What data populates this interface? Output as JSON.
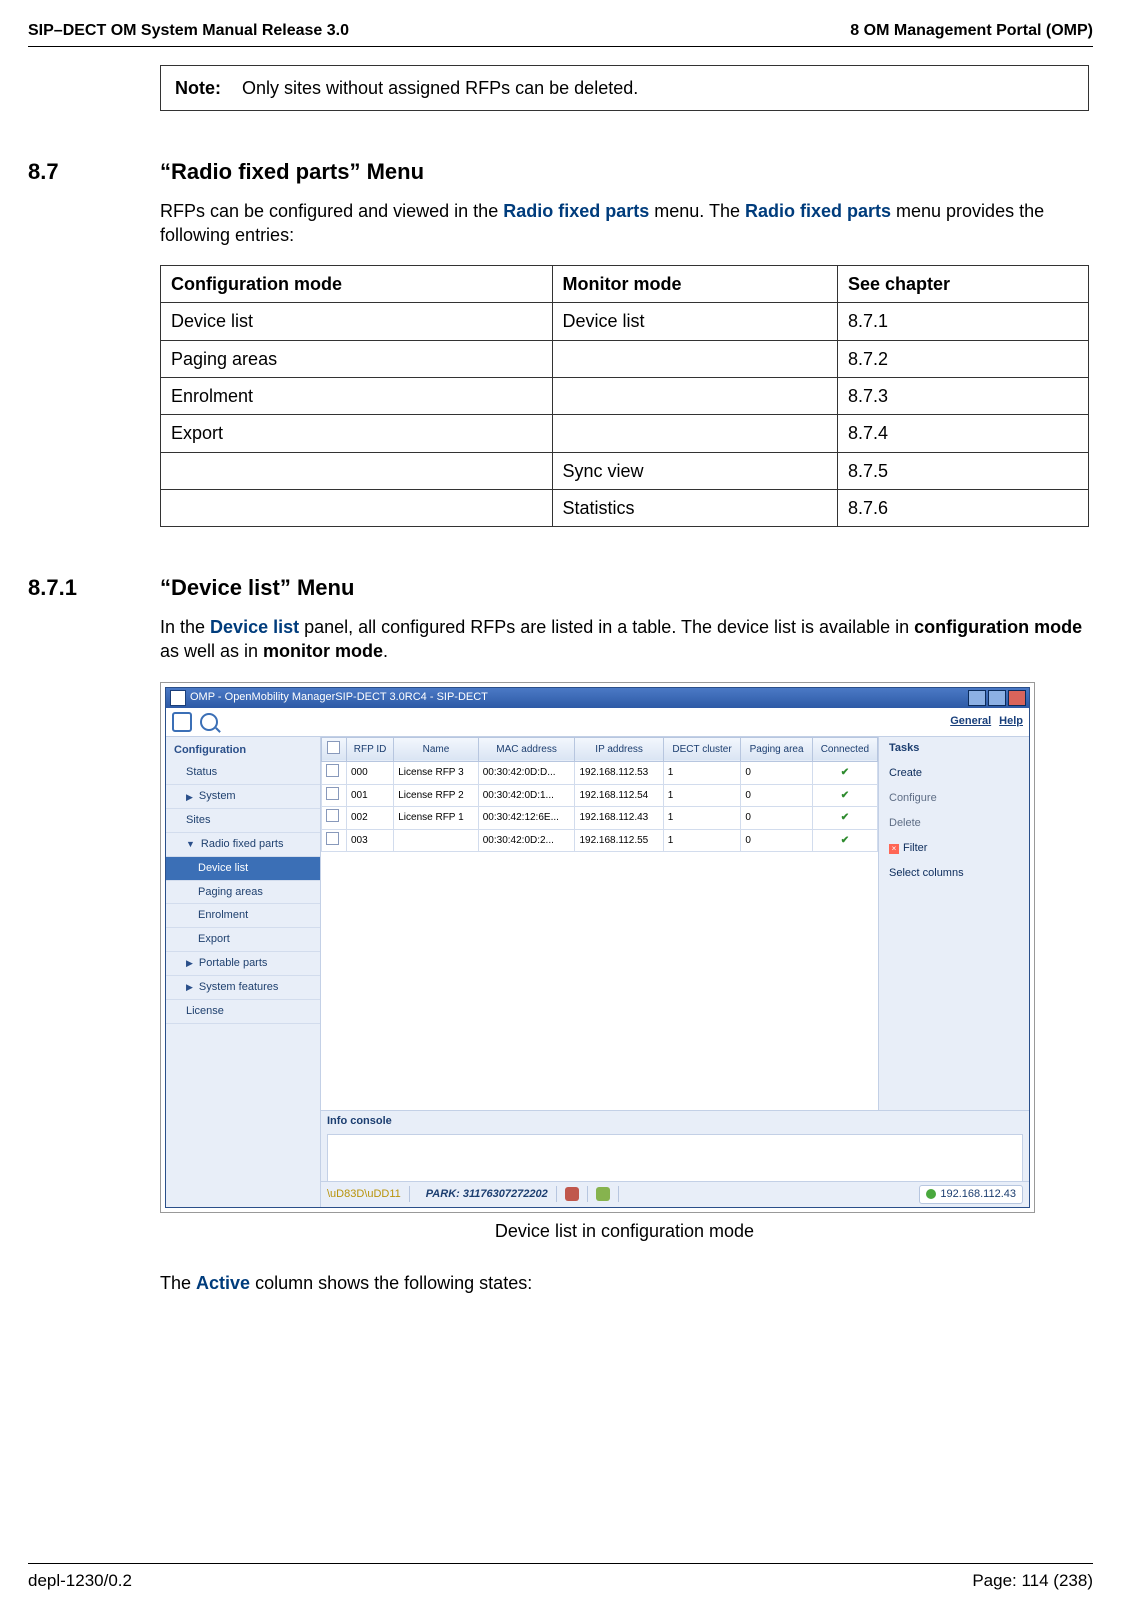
{
  "header": {
    "left": "SIP–DECT OM System Manual Release 3.0",
    "right": "8 OM Management Portal (OMP)"
  },
  "note": {
    "label": "Note:",
    "text": "Only sites without assigned RFPs can be deleted."
  },
  "sec87": {
    "num": "8.7",
    "title": "“Radio fixed parts” Menu",
    "p_pre": "RFPs can be configured and viewed in the ",
    "p_link1": "Radio fixed parts",
    "p_mid": " menu. The ",
    "p_link2": "Radio fixed parts",
    "p_post": " menu provides the following entries:",
    "thead": [
      "Configuration mode",
      "Monitor mode",
      "See chapter"
    ],
    "rows": [
      [
        "Device list",
        "Device list",
        "8.7.1"
      ],
      [
        "Paging areas",
        "",
        "8.7.2"
      ],
      [
        "Enrolment",
        "",
        "8.7.3"
      ],
      [
        "Export",
        "",
        "8.7.4"
      ],
      [
        "",
        "Sync view",
        "8.7.5"
      ],
      [
        "",
        "Statistics",
        "8.7.6"
      ]
    ]
  },
  "sec871": {
    "num": "8.7.1",
    "title": "“Device list” Menu",
    "p1_pre": "In the ",
    "p1_link": "Device list",
    "p1_mid": " panel, all configured RFPs are listed in a table. The device list is available in ",
    "p1_b1": "configuration mode",
    "p1_mid2": " as well as in ",
    "p1_b2": "monitor mode",
    "p1_end": "."
  },
  "screenshot": {
    "win_title": "OMP - OpenMobility ManagerSIP-DECT 3.0RC4 - SIP-DECT",
    "general": "General",
    "help": "Help",
    "sidebar_title": "Configuration",
    "sidebar": [
      {
        "label": "Status",
        "depth": 1,
        "sel": false,
        "arrow": ""
      },
      {
        "label": "System",
        "depth": 0,
        "sel": false,
        "arrow": "▶"
      },
      {
        "label": "Sites",
        "depth": 1,
        "sel": false,
        "arrow": ""
      },
      {
        "label": "Radio fixed parts",
        "depth": 0,
        "sel": false,
        "arrow": "▼"
      },
      {
        "label": "Device list",
        "depth": 2,
        "sel": true,
        "arrow": ""
      },
      {
        "label": "Paging areas",
        "depth": 2,
        "sel": false,
        "arrow": ""
      },
      {
        "label": "Enrolment",
        "depth": 2,
        "sel": false,
        "arrow": ""
      },
      {
        "label": "Export",
        "depth": 2,
        "sel": false,
        "arrow": ""
      },
      {
        "label": "Portable parts",
        "depth": 0,
        "sel": false,
        "arrow": "▶"
      },
      {
        "label": "System features",
        "depth": 0,
        "sel": false,
        "arrow": "▶"
      },
      {
        "label": "License",
        "depth": 1,
        "sel": false,
        "arrow": ""
      }
    ],
    "columns": [
      "",
      "RFP ID",
      "Name",
      "MAC address",
      "IP address",
      "DECT cluster",
      "Paging area",
      "Connected"
    ],
    "rows": [
      {
        "id": "000",
        "name": "License RFP 3",
        "mac": "00:30:42:0D:D...",
        "ip": "192.168.112.53",
        "cluster": "1",
        "pa": "0",
        "conn": "✔"
      },
      {
        "id": "001",
        "name": "License RFP 2",
        "mac": "00:30:42:0D:1...",
        "ip": "192.168.112.54",
        "cluster": "1",
        "pa": "0",
        "conn": "✔"
      },
      {
        "id": "002",
        "name": "License RFP 1",
        "mac": "00:30:42:12:6E...",
        "ip": "192.168.112.43",
        "cluster": "1",
        "pa": "0",
        "conn": "✔"
      },
      {
        "id": "003",
        "name": "",
        "mac": "00:30:42:0D:2...",
        "ip": "192.168.112.55",
        "cluster": "1",
        "pa": "0",
        "conn": "✔"
      }
    ],
    "tasks_hdr": "Tasks",
    "tasks": [
      {
        "label": "Create",
        "active": true
      },
      {
        "label": "Configure",
        "active": false
      },
      {
        "label": "Delete",
        "active": false
      },
      {
        "label": "Filter",
        "active": true,
        "x": true
      },
      {
        "label": "Select columns",
        "active": true
      }
    ],
    "info_console": "Info console",
    "park": "PARK: 31176307272202",
    "status_ip": "192.168.112.43"
  },
  "fig_caption": "Device list in configuration mode",
  "p_active_pre": "The ",
  "p_active_link": "Active",
  "p_active_post": " column shows the following states:",
  "footer": {
    "left": "depl-1230/0.2",
    "right": "Page: 114 (238)"
  }
}
